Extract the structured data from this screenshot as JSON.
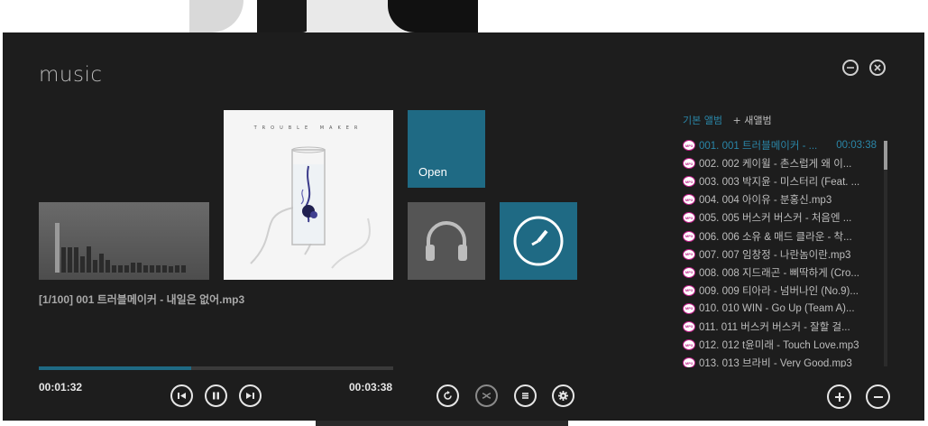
{
  "window": {
    "title": "music"
  },
  "album": {
    "art_title": "TROUBLE MAKER"
  },
  "tiles": {
    "open_label": "Open"
  },
  "player": {
    "now_playing": "[1/100] 001 트러블메이커 - 내일은 없어.mp3",
    "elapsed": "00:01:32",
    "total": "00:03:38",
    "progress_fraction": 0.43
  },
  "visualizer": {
    "levels": [
      0.78,
      0.4,
      0.4,
      0.4,
      0.25,
      0.42,
      0.2,
      0.3,
      0.2,
      0.12,
      0.12,
      0.12,
      0.15,
      0.15,
      0.12,
      0.12,
      0.12,
      0.12,
      0.1,
      0.12,
      0.12
    ]
  },
  "albums": {
    "default_label": "기본 앨범",
    "new_label": "+ 새앨범"
  },
  "playlist": [
    {
      "name": "001. 001 트러블메이커 - ...",
      "duration": "00:03:38",
      "active": true
    },
    {
      "name": "002. 002 케이윌 - 촌스럽게 왜 이...",
      "duration": ""
    },
    {
      "name": "003. 003 박지윤 - 미스터리 (Feat. ...",
      "duration": ""
    },
    {
      "name": "004. 004 아이유 - 분홍신.mp3",
      "duration": ""
    },
    {
      "name": "005. 005 버스커 버스커 - 처음엔 ...",
      "duration": ""
    },
    {
      "name": "006. 006 소유 & 매드 클라운 - 착...",
      "duration": ""
    },
    {
      "name": "007. 007 임창정 - 나란놈이란.mp3",
      "duration": ""
    },
    {
      "name": "008. 008 지드래곤 - 삐딱하게 (Cro...",
      "duration": ""
    },
    {
      "name": "009. 009 티아라 - 넘버나인 (No.9)...",
      "duration": ""
    },
    {
      "name": "010. 010 WIN - Go Up (Team A)...",
      "duration": ""
    },
    {
      "name": "011. 011 버스커 버스커 - 잘할 걸...",
      "duration": ""
    },
    {
      "name": "012. 012 t윤미래 - Touch Love.mp3",
      "duration": ""
    },
    {
      "name": "013. 013 브라비 - Very Good.mp3",
      "duration": ""
    }
  ],
  "icons": {
    "minimize": "minimize-icon",
    "close": "close-icon",
    "prev": "skip-back-icon",
    "pause": "pause-icon",
    "next": "skip-forward-icon",
    "repeat": "repeat-icon",
    "shuffle": "shuffle-icon",
    "list": "list-icon",
    "settings": "gear-icon",
    "add": "plus-icon",
    "remove": "minus-icon",
    "headphones": "headphones-icon",
    "clock": "clock-icon",
    "file": "mp3-file-icon"
  },
  "colors": {
    "accent": "#1f6a84",
    "accent_text": "#2a86a8",
    "background": "#1d1d1d"
  }
}
